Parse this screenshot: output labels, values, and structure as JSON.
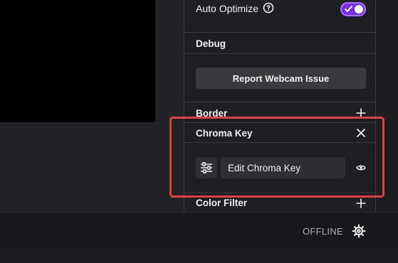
{
  "auto_optimize": {
    "label": "Auto Optimize",
    "enabled": true,
    "help_icon": "help-circle-icon"
  },
  "debug": {
    "title": "Debug",
    "report_button": "Report Webcam Issue"
  },
  "border": {
    "title": "Border",
    "action_icon": "plus-icon"
  },
  "chroma_key": {
    "title": "Chroma Key",
    "action_icon": "close-icon",
    "edit_button": "Edit Chroma Key",
    "settings_icon": "sliders-icon",
    "visibility_icon": "eye-icon"
  },
  "color_filter": {
    "title": "Color Filter",
    "action_icon": "plus-icon"
  },
  "status_bar": {
    "status": "OFFLINE",
    "settings_icon": "gear-icon"
  },
  "colors": {
    "accent": "#772ce8",
    "highlight": "#e0403f"
  }
}
